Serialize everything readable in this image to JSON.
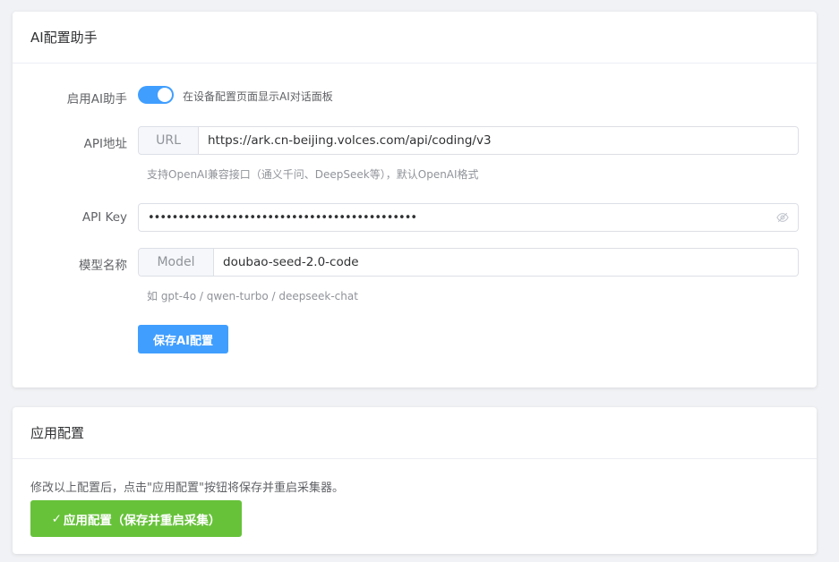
{
  "ai_card": {
    "title": "AI配置助手",
    "enable": {
      "label": "启用AI助手",
      "checked": true,
      "description": "在设备配置页面显示AI对话面板"
    },
    "api_url": {
      "label": "API地址",
      "prepend": "URL",
      "value": "https://ark.cn-beijing.volces.com/api/coding/v3",
      "hint": "支持OpenAI兼容接口（通义千问、DeepSeek等），默认OpenAI格式"
    },
    "api_key": {
      "label": "API Key",
      "masked_value": "•••••••••••••••••••••••••••••••••••••••••••••",
      "icon": "eye-off-icon"
    },
    "model": {
      "label": "模型名称",
      "prepend": "Model",
      "value": "doubao-seed-2.0-code",
      "hint": "如 gpt-4o / qwen-turbo / deepseek-chat"
    },
    "save_button": "保存AI配置"
  },
  "apply_card": {
    "title": "应用配置",
    "description": "修改以上配置后，点击\"应用配置\"按钮将保存并重启采集器。",
    "apply_button": "应用配置（保存并重启采集）",
    "apply_button_icon": "✓"
  },
  "colors": {
    "primary": "#409eff",
    "success": "#67c23a",
    "background": "#f0f2f5"
  }
}
